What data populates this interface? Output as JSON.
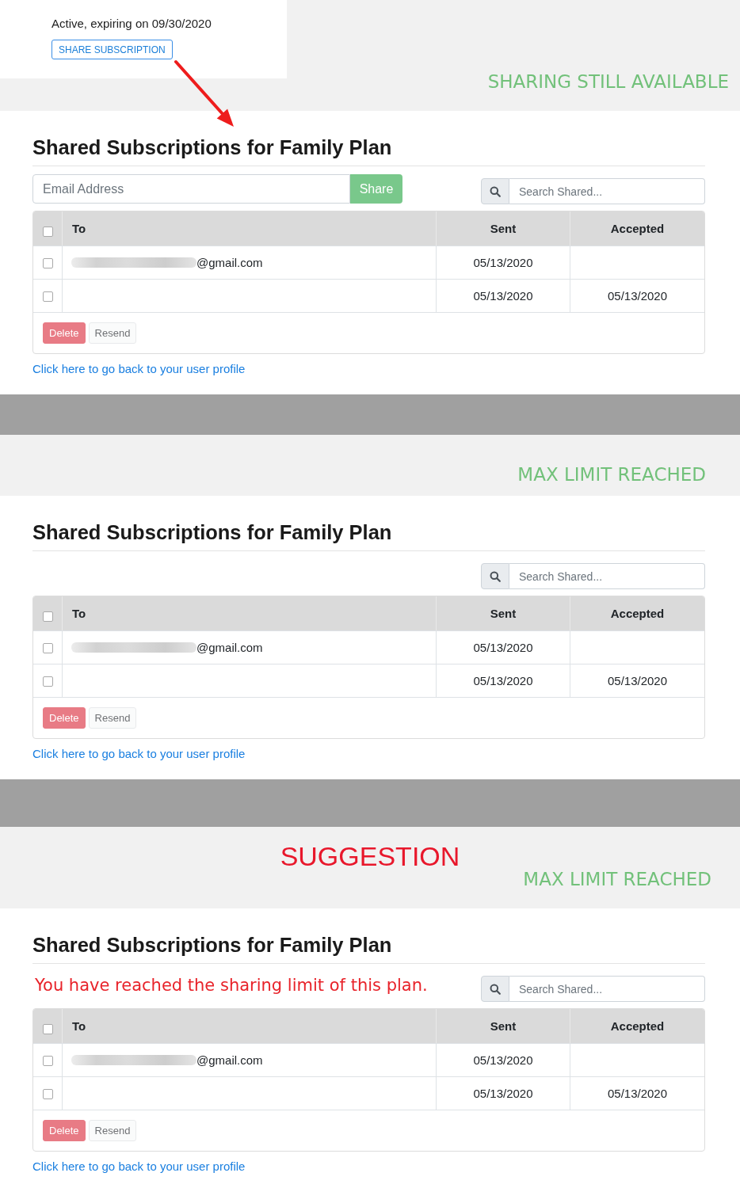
{
  "sections": [
    {
      "banner": {
        "card": {
          "status": "Active, expiring on 09/30/2020",
          "button": "SHARE SUBSCRIPTION"
        },
        "caption": "SHARING STILL AVAILABLE"
      },
      "panel": {
        "title": "Shared Subscriptions for Family Plan",
        "share_form": {
          "placeholder": "Email Address",
          "button": "Share",
          "disabled": true
        },
        "search": {
          "placeholder": "Search Shared..."
        },
        "table": {
          "select_all": {
            "checked": false
          },
          "columns": [
            "To",
            "Sent",
            "Accepted"
          ],
          "rows": [
            {
              "checked": false,
              "to_blurred": true,
              "to": "@gmail.com",
              "sent": "05/13/2020"
            },
            {
              "checked": false,
              "to_blurred": false,
              "sent": "05/13/2020",
              "accepted": "05/13/2020"
            }
          ]
        },
        "actions": [
          {
            "kind": "danger",
            "label": "Delete",
            "disabled": true
          },
          {
            "kind": "light",
            "label": "Resend",
            "disabled": true
          }
        ],
        "link": "Click here to go back to your user profile"
      }
    },
    {
      "banner": {
        "caption": "MAX LIMIT REACHED"
      },
      "panel": {
        "title": "Shared Subscriptions for Family Plan",
        "search": {
          "placeholder": "Search Shared..."
        },
        "table": {
          "select_all": {
            "checked": false
          },
          "columns": [
            "To",
            "Sent",
            "Accepted"
          ],
          "rows": [
            {
              "checked": false,
              "to_blurred": true,
              "to": "@gmail.com",
              "sent": "05/13/2020"
            },
            {
              "checked": false,
              "to_blurred": false,
              "sent": "05/13/2020",
              "accepted": "05/13/2020"
            }
          ]
        },
        "actions": [
          {
            "kind": "danger",
            "label": "Delete",
            "disabled": true
          },
          {
            "kind": "light",
            "label": "Resend",
            "disabled": true
          }
        ],
        "link": "Click here to go back to your user profile"
      }
    },
    {
      "banner": {
        "heading": "SUGGESTION",
        "caption": "MAX LIMIT REACHED"
      },
      "panel": {
        "title": "Shared Subscriptions for Family Plan",
        "notice": "You have reached the sharing limit of this plan.",
        "search": {
          "placeholder": "Search Shared..."
        },
        "table": {
          "select_all": {
            "checked": false
          },
          "columns": [
            "To",
            "Sent",
            "Accepted"
          ],
          "rows": [
            {
              "checked": false,
              "to_blurred": true,
              "to": "@gmail.com",
              "sent": "05/13/2020"
            },
            {
              "checked": false,
              "to_blurred": false,
              "sent": "05/13/2020",
              "accepted": "05/13/2020"
            }
          ]
        },
        "actions": [
          {
            "kind": "danger",
            "label": "Delete",
            "disabled": true
          },
          {
            "kind": "light",
            "label": "Resend",
            "disabled": true
          }
        ],
        "link": "Click here to go back to your user profile"
      }
    }
  ]
}
